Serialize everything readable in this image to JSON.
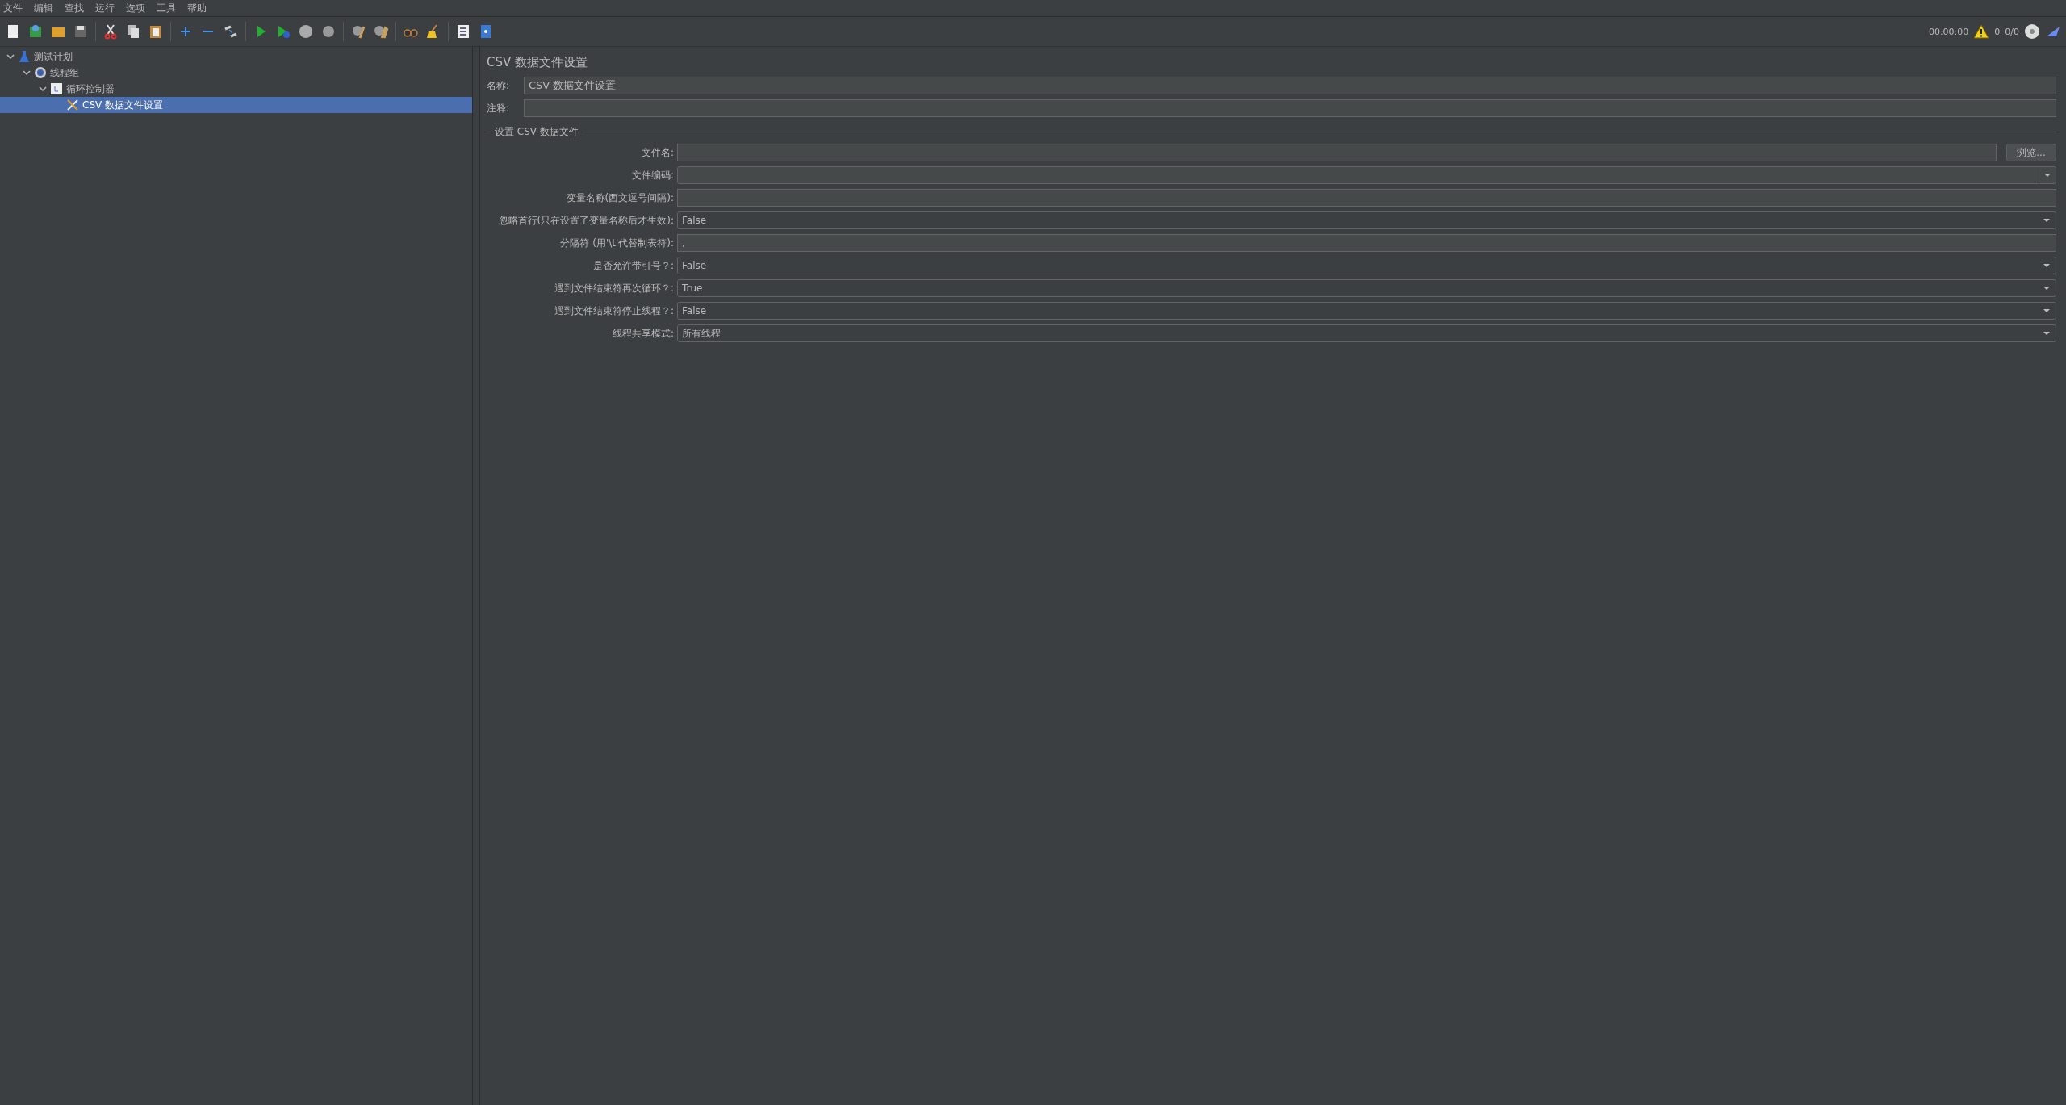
{
  "menu": [
    "文件",
    "编辑",
    "查找",
    "运行",
    "选项",
    "工具",
    "帮助"
  ],
  "status": {
    "elapsed": "00:00:00",
    "warnings": "0",
    "threads": "0/0"
  },
  "tree": [
    {
      "label": "测试计划",
      "kind": "plan",
      "expanded": true,
      "selected": false,
      "children": [
        {
          "label": "线程组",
          "kind": "threads",
          "expanded": true,
          "selected": false,
          "children": [
            {
              "label": "循环控制器",
              "kind": "loop",
              "expanded": true,
              "selected": false,
              "children": [
                {
                  "label": "CSV 数据文件设置",
                  "kind": "config",
                  "selected": true
                }
              ]
            }
          ]
        }
      ]
    }
  ],
  "panel": {
    "title": "CSV 数据文件设置",
    "name": {
      "label": "名称:",
      "value": "CSV 数据文件设置"
    },
    "comment": {
      "label": "注释:"
    },
    "group_title": "设置 CSV 数据文件",
    "fields": [
      {
        "kind": "file",
        "label": "文件名:",
        "button": "浏览..."
      },
      {
        "kind": "combo",
        "label": "文件编码:"
      },
      {
        "kind": "text",
        "label": "变量名称(西文逗号间隔):"
      },
      {
        "kind": "select",
        "label": "忽略首行(只在设置了变量名称后才生效):",
        "value": "False"
      },
      {
        "kind": "text",
        "label": "分隔符 (用'\\t'代替制表符):",
        "value": ","
      },
      {
        "kind": "select",
        "label": "是否允许带引号？:",
        "value": "False"
      },
      {
        "kind": "select",
        "label": "遇到文件结束符再次循环？:",
        "value": "True"
      },
      {
        "kind": "select",
        "label": "遇到文件结束符停止线程？:",
        "value": "False"
      },
      {
        "kind": "select",
        "label": "线程共享模式:",
        "value": "所有线程"
      }
    ]
  }
}
